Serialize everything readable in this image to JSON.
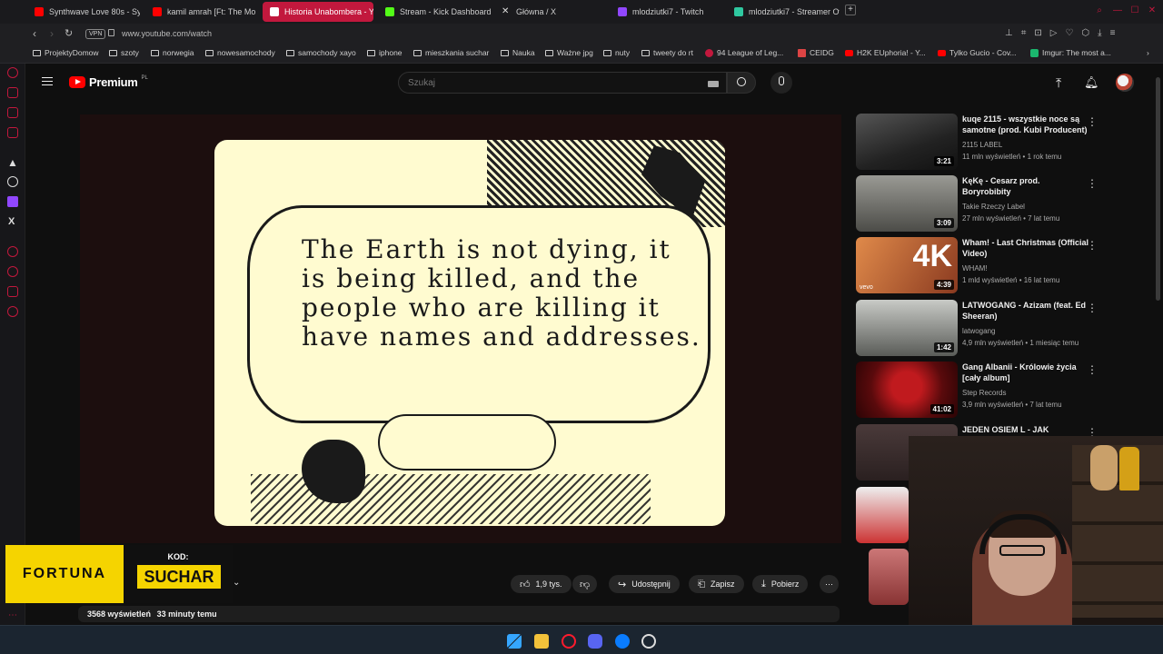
{
  "browser": {
    "tabs": [
      {
        "label": "Synthwave Love 80s - Sy",
        "active": false,
        "icon": "youtube-icon"
      },
      {
        "label": "kamil amrah [Ft: The Mo",
        "active": false,
        "icon": "youtube-icon"
      },
      {
        "label": "Historia Unabombera - Yo",
        "active": true,
        "icon": "youtube-icon"
      },
      {
        "label": "Stream - Kick Dashboard",
        "active": false,
        "icon": "kick-icon"
      },
      {
        "label": "Główna / X",
        "active": false,
        "icon": "x-icon"
      },
      {
        "label": "mlodziutki7 - Twitch",
        "active": false,
        "icon": "twitch-icon"
      },
      {
        "label": "mlodziutki7 - Streamer Ov",
        "active": false,
        "icon": "streamer-icon"
      }
    ],
    "url": "www.youtube.com/watch",
    "vpn_label": "VPN",
    "bookmarks": [
      "ProjektyDomow",
      "szoty",
      "norwegia",
      "nowesamochody",
      "samochody xayo",
      "iphone",
      "mieszkania suchar",
      "Nauka",
      "Ważne jpg",
      "nuty",
      "tweety do rt",
      "94 League of Leg...",
      "CEIDG",
      "H2K EUphoria! - Y...",
      "Tylko Gucio - Cov...",
      "Imgur: The most a..."
    ]
  },
  "youtube": {
    "logo_text": "Premium",
    "logo_region": "PL",
    "search_placeholder": "Szukaj",
    "video": {
      "quote": "The Earth is not dying, it is being killed, and the people who are killing it have names and addresses."
    },
    "actions": {
      "likes": "1,9 tys.",
      "share": "Udostępnij",
      "save": "Zapisz",
      "download": "Pobierz"
    },
    "stats": {
      "views": "3568 wyświetleń",
      "time": "33 minuty temu"
    },
    "recommendations": [
      {
        "title": "kuqe 2115 - wszystkie noce są samotne (prod. Kubi Producent)",
        "channel": "2115 LABEL",
        "meta": "11 mln wyświetleń • 1 rok temu",
        "duration": "3:21",
        "thumb_color": "#3a3a3a"
      },
      {
        "title": "KęKę - Cesarz prod. Boryrobibity",
        "channel": "Takie Rzeczy Label",
        "meta": "27 mln wyświetleń • 7 lat temu",
        "duration": "3:09",
        "thumb_color": "#6f6f6a"
      },
      {
        "title": "Wham! - Last Christmas (Official Video)",
        "channel": "WHAM!",
        "meta": "1 mld wyświetleń • 16 lat temu",
        "duration": "4:39",
        "thumb_color": "#b65a2f",
        "badge": "4K",
        "vevo": "vevo"
      },
      {
        "title": "LATWOGANG - Azizam (feat. Ed Sheeran)",
        "channel": "latwogang",
        "meta": "4,9 mln wyświetleń • 1 miesiąc temu",
        "duration": "1:42",
        "thumb_color": "#8d8f88"
      },
      {
        "title": "Gang Albanii - Królowie życia [cały album]",
        "channel": "Step Records",
        "meta": "3,9 mln wyświetleń • 7 lat temu",
        "duration": "41:02",
        "thumb_color": "#7a0f12"
      },
      {
        "title": "JEDEN OSIEM L - JAK",
        "channel": "",
        "meta": "",
        "duration": "",
        "thumb_color": "#3b2c2c"
      }
    ]
  },
  "overlays": {
    "fortuna_brand": "FORTUNA",
    "kod_label": "KOD:",
    "kod_value": "SUCHAR"
  },
  "colors": {
    "accent": "#c2183d",
    "youtube_red": "#ff0000",
    "fortuna_yellow": "#f5d400"
  }
}
